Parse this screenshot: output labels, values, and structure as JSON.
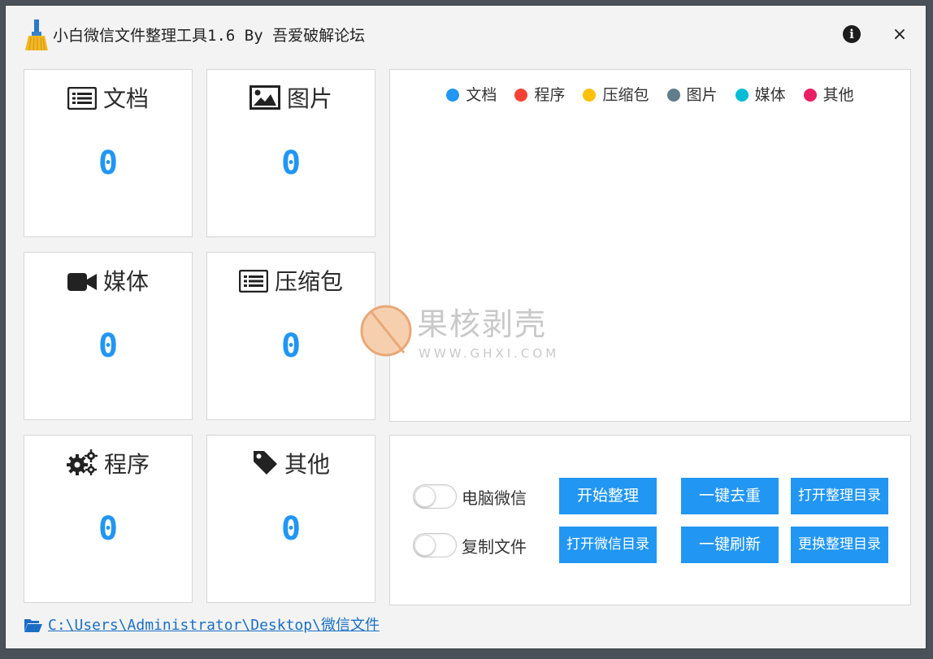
{
  "window": {
    "title": "小白微信文件整理工具1.6 By 吾爱破解论坛",
    "close_label": "×",
    "info_label": "i"
  },
  "cards": [
    {
      "label": "文档",
      "value": "0",
      "icon": "document-list-icon"
    },
    {
      "label": "图片",
      "value": "0",
      "icon": "image-icon"
    },
    {
      "label": "媒体",
      "value": "0",
      "icon": "video-camera-icon"
    },
    {
      "label": "压缩包",
      "value": "0",
      "icon": "archive-list-icon"
    },
    {
      "label": "程序",
      "value": "0",
      "icon": "gears-icon"
    },
    {
      "label": "其他",
      "value": "0",
      "icon": "tag-icon"
    }
  ],
  "chart": {
    "legend": [
      {
        "label": "文档",
        "color": "#2196f3"
      },
      {
        "label": "程序",
        "color": "#f44336"
      },
      {
        "label": "压缩包",
        "color": "#ffc107"
      },
      {
        "label": "图片",
        "color": "#607d8b"
      },
      {
        "label": "媒体",
        "color": "#00bcd4"
      },
      {
        "label": "其他",
        "color": "#e91e63"
      }
    ]
  },
  "watermark": {
    "name": "果核剥壳",
    "url": "WWW.GHXI.COM"
  },
  "controls": {
    "toggle_pc_wechat": "电脑微信",
    "toggle_copy_files": "复制文件",
    "btn_start": "开始整理",
    "btn_dedupe": "一键去重",
    "btn_open_sorted_dir": "打开整理目录",
    "btn_open_wechat_dir": "打开微信目录",
    "btn_refresh": "一键刷新",
    "btn_change_sorted_dir": "更换整理目录"
  },
  "path": {
    "value": "C:\\Users\\Administrator\\Desktop\\微信文件"
  },
  "colors": {
    "accent": "#2196f3"
  }
}
